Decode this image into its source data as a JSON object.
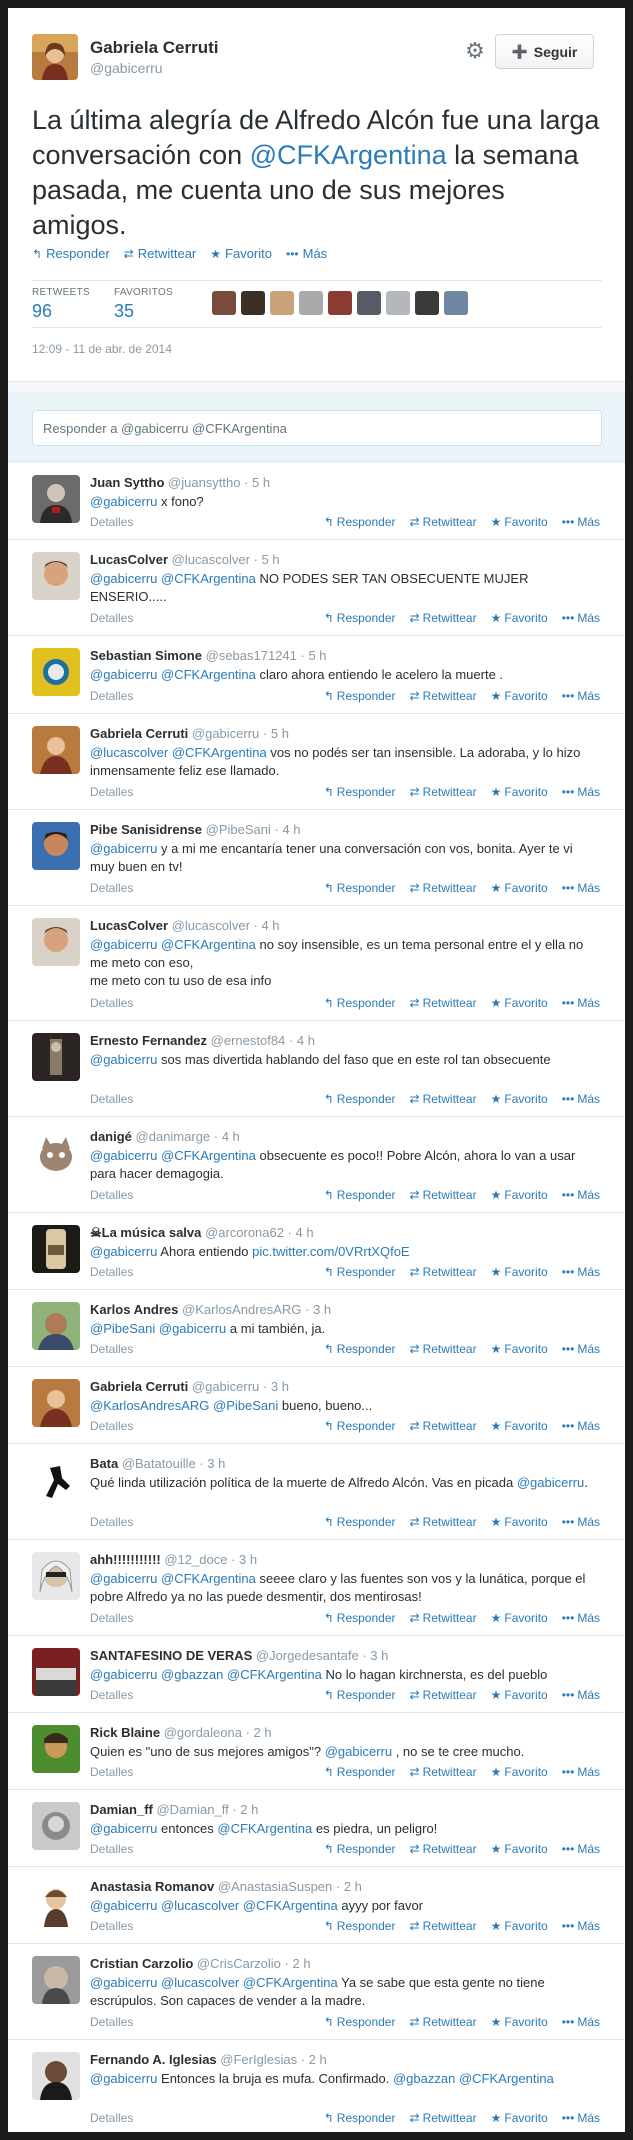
{
  "main_tweet": {
    "name": "Gabriela Cerruti",
    "handle": "@gabicerru",
    "follow_label": "Seguir",
    "text_before": "La última alegría de Alfredo Alcón fue una larga conversación con ",
    "text_mention": "@CFKArgentina",
    "text_after": " la semana pasada, me cuenta uno de sus mejores amigos.",
    "actions": {
      "reply": "Responder",
      "retweet": "Retwittear",
      "favorite": "Favorito",
      "more": "Más"
    },
    "stats": {
      "retweets_label": "RETWEETS",
      "retweets_count": "96",
      "favorites_label": "FAVORITOS",
      "favorites_count": "35"
    },
    "timestamp": "12:09 - 11 de abr. de 2014"
  },
  "reply_box": {
    "placeholder": "Responder a @gabicerru @CFKArgentina"
  },
  "footer_labels": {
    "details": "Detalles",
    "reply": "Responder",
    "retweet": "Retwittear",
    "favorite": "Favorito",
    "more": "Más"
  },
  "replies": [
    {
      "name": "Juan Syttho",
      "handle": "@juansyttho",
      "time": "5 h",
      "parts": [
        {
          "m": "@gabicerru"
        },
        {
          "t": " x fono?"
        }
      ]
    },
    {
      "name": "LucasColver",
      "handle": "@lucascolver",
      "time": "5 h",
      "parts": [
        {
          "m": "@gabicerru"
        },
        {
          "t": " "
        },
        {
          "m": "@CFKArgentina"
        },
        {
          "t": " NO PODES SER TAN OBSECUENTE MUJER ENSERIO....."
        }
      ]
    },
    {
      "name": "Sebastian Simone",
      "handle": "@sebas171241",
      "time": "5 h",
      "parts": [
        {
          "m": "@gabicerru"
        },
        {
          "t": " "
        },
        {
          "m": "@CFKArgentina"
        },
        {
          "t": " claro ahora entiendo le acelero la muerte ."
        }
      ]
    },
    {
      "name": "Gabriela Cerruti",
      "handle": "@gabicerru",
      "time": "5 h",
      "parts": [
        {
          "m": "@lucascolver"
        },
        {
          "t": " "
        },
        {
          "m": "@CFKArgentina"
        },
        {
          "t": " vos no podés ser tan insensible. La adoraba, y lo hizo inmensamente feliz ese llamado."
        }
      ]
    },
    {
      "name": "Pibe Sanisidrense",
      "handle": "@PibeSani",
      "time": "4 h",
      "parts": [
        {
          "m": "@gabicerru"
        },
        {
          "t": " y a mi me encantaría tener una conversación con vos, bonita. Ayer te vi muy buen en tv!"
        }
      ]
    },
    {
      "name": "LucasColver",
      "handle": "@lucascolver",
      "time": "4 h",
      "parts": [
        {
          "m": "@gabicerru"
        },
        {
          "t": " "
        },
        {
          "m": "@CFKArgentina"
        },
        {
          "t": " no soy insensible, es un tema personal entre el y ella no me meto con eso,\nme meto con tu uso de esa info"
        }
      ]
    },
    {
      "name": "Ernesto Fernandez",
      "handle": "@ernestof84",
      "time": "4 h",
      "parts": [
        {
          "m": "@gabicerru"
        },
        {
          "t": " sos mas divertida hablando del faso que en este rol tan obsecuente"
        }
      ]
    },
    {
      "name": "danigé",
      "handle": "@danimarge",
      "time": "4 h",
      "parts": [
        {
          "m": "@gabicerru"
        },
        {
          "t": " "
        },
        {
          "m": "@CFKArgentina"
        },
        {
          "t": " obsecuente es poco!! Pobre Alcón, ahora lo van a usar para hacer demagogia."
        }
      ]
    },
    {
      "name": "☠La música salva",
      "handle": "@arcorona62",
      "time": "4 h",
      "parts": [
        {
          "m": "@gabicerru"
        },
        {
          "t": " Ahora entiendo "
        },
        {
          "m": "pic.twitter.com/0VRrtXQfoE"
        }
      ]
    },
    {
      "name": "Karlos Andres",
      "handle": "@KarlosAndresARG",
      "time": "3 h",
      "parts": [
        {
          "m": "@PibeSani"
        },
        {
          "t": " "
        },
        {
          "m": "@gabicerru"
        },
        {
          "t": " a mi también, ja."
        }
      ]
    },
    {
      "name": "Gabriela Cerruti",
      "handle": "@gabicerru",
      "time": "3 h",
      "parts": [
        {
          "m": "@KarlosAndresARG"
        },
        {
          "t": " "
        },
        {
          "m": "@PibeSani"
        },
        {
          "t": " bueno, bueno..."
        }
      ]
    },
    {
      "name": "Bata",
      "handle": "@Batatouille",
      "time": "3 h",
      "parts": [
        {
          "t": "Qué linda utilización política de la muerte de Alfredo Alcón. Vas en picada "
        },
        {
          "m": "@gabicerru"
        },
        {
          "t": "."
        }
      ]
    },
    {
      "name": "ahh!!!!!!!!!!!",
      "handle": "@12_doce",
      "time": "3 h",
      "parts": [
        {
          "m": "@gabicerru"
        },
        {
          "t": " "
        },
        {
          "m": "@CFKArgentina"
        },
        {
          "t": " seeee claro y las fuentes son vos y la lunática, porque el pobre Alfredo ya no las puede desmentir, dos mentirosas!"
        }
      ]
    },
    {
      "name": "SANTAFESINO DE VERAS",
      "handle": "@Jorgedesantafe",
      "time": "3 h",
      "parts": [
        {
          "m": "@gabicerru"
        },
        {
          "t": " "
        },
        {
          "m": "@gbazzan"
        },
        {
          "t": " "
        },
        {
          "m": "@CFKArgentina"
        },
        {
          "t": " No lo hagan kirchnersta, es del pueblo"
        }
      ]
    },
    {
      "name": "Rick Blaine",
      "handle": "@gordaleona",
      "time": "2 h",
      "parts": [
        {
          "t": "Quien es \"uno de sus mejores amigos\"? "
        },
        {
          "m": "@gabicerru"
        },
        {
          "t": " , no se te cree mucho."
        }
      ]
    },
    {
      "name": "Damian_ff",
      "handle": "@Damian_ff",
      "time": "2 h",
      "parts": [
        {
          "m": "@gabicerru"
        },
        {
          "t": " entonces "
        },
        {
          "m": "@CFKArgentina"
        },
        {
          "t": " es piedra, un peligro!"
        }
      ]
    },
    {
      "name": "Anastasia Romanov",
      "handle": "@AnastasiaSuspen",
      "time": "2 h",
      "parts": [
        {
          "m": "@gabicerru"
        },
        {
          "t": " "
        },
        {
          "m": "@lucascolver"
        },
        {
          "t": " "
        },
        {
          "m": "@CFKArgentina"
        },
        {
          "t": " ayyy por favor"
        }
      ]
    },
    {
      "name": "Cristian Carzolio",
      "handle": "@CrisCarzolio",
      "time": "2 h",
      "parts": [
        {
          "m": "@gabicerru"
        },
        {
          "t": " "
        },
        {
          "m": "@lucascolver"
        },
        {
          "t": " "
        },
        {
          "m": "@CFKArgentina"
        },
        {
          "t": " Ya se sabe que esta gente no tiene escrúpulos. Son capaces de vender a la madre."
        }
      ]
    },
    {
      "name": "Fernando A. Iglesias",
      "handle": "@FerIglesias",
      "time": "2 h",
      "parts": [
        {
          "m": "@gabicerru"
        },
        {
          "t": " Entonces la bruja es mufa. Confirmado. "
        },
        {
          "m": "@gbazzan"
        },
        {
          "t": " "
        },
        {
          "m": "@CFKArgentina"
        }
      ]
    }
  ]
}
